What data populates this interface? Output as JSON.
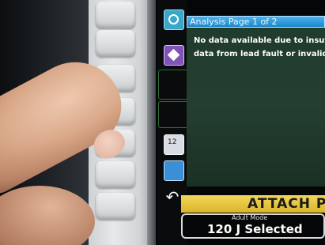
{
  "screen": {
    "title": "Analysis Page 1 of 2",
    "message_lines": [
      "No data available due to insuffic",
      "data from lead fault or invalid ca"
    ],
    "alert": "ATTACH P",
    "mode_label": "Adult Mode",
    "energy_selected": "120 J Selected",
    "calendar_icon_number": "12"
  },
  "icons": [
    "graph-icon",
    "diamond-icon",
    "calendar-icon",
    "people-icon",
    "back-arrow-icon"
  ],
  "colors": {
    "title_bar": "#2f9fe0",
    "alert_bar": "#e8c640",
    "content_bg": "#213d2c",
    "bezel": "#dfe1e2"
  }
}
